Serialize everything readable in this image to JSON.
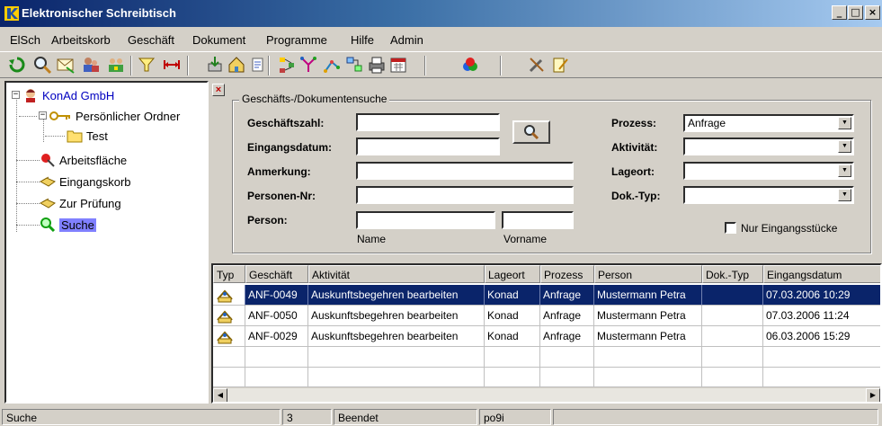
{
  "window": {
    "title": "Elektronischer Schreibtisch",
    "minimize": "_",
    "maximize": "□",
    "close": "×"
  },
  "menu": [
    "ElSch",
    "Arbeitskorb",
    "Geschäft",
    "Dokument",
    "Programme",
    "Hilfe",
    "Admin"
  ],
  "toolbar_icons": [
    "refresh-icon",
    "search-icon",
    "mail-icon",
    "users-icon",
    "user-group-icon",
    "filter-icon",
    "fit-width-icon",
    "import-icon",
    "home-chart-icon",
    "note-icon",
    "flow-icon",
    "branch-icon",
    "tree-graph-icon",
    "network-icon",
    "print-icon",
    "calendar-icon",
    "puzzle-icon",
    "tools-icon",
    "edit-document-icon"
  ],
  "tree": {
    "root": "KonAd GmbH",
    "personal_folder": "Persönlicher Ordner",
    "test": "Test",
    "workspace": "Arbeitsfläche",
    "inbox": "Eingangskorb",
    "review": "Zur Prüfung",
    "search": "Suche"
  },
  "search_form": {
    "legend": "Geschäfts-/Dokumentensuche",
    "geschaeftszahl_label": "Geschäftszahl:",
    "eingangsdatum_label": "Eingangsdatum:",
    "anmerkung_label": "Anmerkung:",
    "personen_nr_label": "Personen-Nr:",
    "person_label": "Person:",
    "name_label": "Name",
    "vorname_label": "Vorname",
    "prozess_label": "Prozess:",
    "prozess_value": "Anfrage",
    "aktivitaet_label": "Aktivität:",
    "lageort_label": "Lageort:",
    "doktyp_label": "Dok.-Typ:",
    "nur_eingang_label": "Nur Eingangsstücke"
  },
  "results": {
    "columns": [
      "Typ",
      "Geschäft",
      "Aktivität",
      "Lageort",
      "Prozess",
      "Person",
      "Dok.-Typ",
      "Eingangsdatum"
    ],
    "rows": [
      {
        "geschaeft": "ANF-0049",
        "aktivitaet": "Auskunftsbegehren bearbeiten",
        "lageort": "Konad",
        "prozess": "Anfrage",
        "person": "Mustermann Petra",
        "doktyp": "",
        "datum": "07.03.2006 10:29"
      },
      {
        "geschaeft": "ANF-0050",
        "aktivitaet": "Auskunftsbegehren bearbeiten",
        "lageort": "Konad",
        "prozess": "Anfrage",
        "person": "Mustermann Petra",
        "doktyp": "",
        "datum": "07.03.2006 11:24"
      },
      {
        "geschaeft": "ANF-0029",
        "aktivitaet": "Auskunftsbegehren bearbeiten",
        "lageort": "Konad",
        "prozess": "Anfrage",
        "person": "Mustermann Petra",
        "doktyp": "",
        "datum": "06.03.2006 15:29"
      }
    ]
  },
  "status": {
    "view": "Suche",
    "count": "3",
    "state": "Beendet",
    "user": "po9i"
  },
  "colors": {
    "title_start": "#0a246a",
    "title_end": "#a6caf0",
    "selection": "#0a246a",
    "tree_highlight": "#8080ff"
  }
}
